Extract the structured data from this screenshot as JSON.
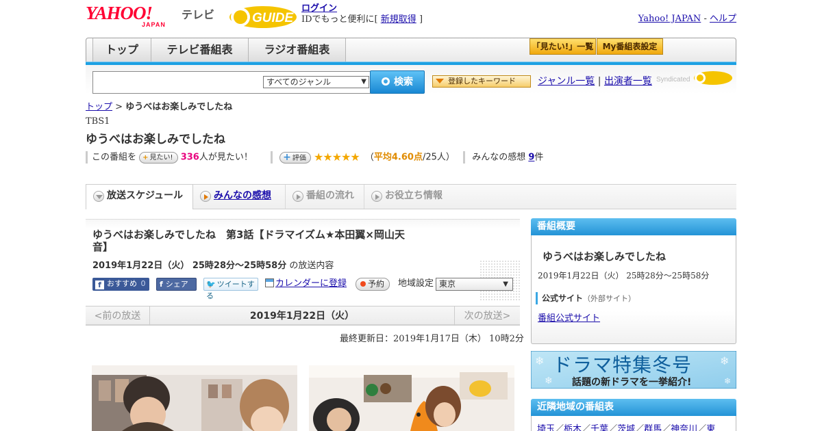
{
  "header": {
    "brand_logo": "YAHOO!",
    "brand_sub": "JAPAN",
    "service_name": "テレビ",
    "gguide_logo": "GUIDE",
    "login_label": "ログイン",
    "login_prefix": "IDでもっと便利に[",
    "signup_label": "新規取得",
    "login_suffix": "]",
    "yahoo_japan_link": "Yahoo! JAPAN",
    "separator": "-",
    "help_link": "ヘルプ"
  },
  "nav": {
    "tabs": [
      "トップ",
      "テレビ番組表",
      "ラジオ番組表"
    ],
    "watchlist_button": "「見たい!」一覧",
    "my_schedule_button": "My番組表設定"
  },
  "search": {
    "genre_selected": "すべてのジャンル",
    "search_button": "検索",
    "keyword_button": "登録したキーワード",
    "genre_list_link": "ジャンル一覧",
    "link_separator": "|",
    "performer_list_link": "出演者一覧",
    "syndicated_label": "Syndicated"
  },
  "breadcrumb": {
    "home": "トップ",
    "separator": ">",
    "current": "ゆうべはお楽しみでしたね"
  },
  "program": {
    "channel": "TBS1",
    "title": "ゆうべはお楽しみでしたね",
    "want_prefix": "この番組を",
    "want_button": "見たい!",
    "want_count": "336",
    "want_suffix": "人が見たい！",
    "rate_button": "評価",
    "stars": "★★★★★",
    "rating_open": "（",
    "rating_avg": "平均4.60点",
    "rating_count": "/25人）",
    "impressions_label": "みんなの感想",
    "impressions_count": "9",
    "impressions_unit": "件"
  },
  "tabs": [
    {
      "label": "放送スケジュール",
      "state": "active"
    },
    {
      "label": "みんなの感想",
      "state": "link"
    },
    {
      "label": "番組の流れ",
      "state": "disabled"
    },
    {
      "label": "お役立ち情報",
      "state": "disabled"
    }
  ],
  "episode": {
    "title": "ゆうべはお楽しみでしたね　第3話【ドラマイズム★本田翼×岡山天音】",
    "airtime": "2019年1月22日（火） 25時28分～25時58分",
    "airtime_suffix": "の放送内容",
    "recommend_button": "おすすめ",
    "recommend_count": "0",
    "share_button": "シェア",
    "tweet_button": "ツイートする",
    "calendar_link": "カレンダーに登録",
    "reserve_button": "予約",
    "region_label": "地域設定",
    "region_selected": "東京"
  },
  "date_nav": {
    "prev": "<前の放送",
    "current": "2019年1月22日（火）",
    "next": "次の放送>"
  },
  "updated": "最終更新日：2019年1月17日（木） 10時2分",
  "sidebar": {
    "overview_heading": "番組概要",
    "overview_title": "ゆうべはお楽しみでしたね",
    "overview_time": "2019年1月22日（火） 25時28分～25時58分",
    "official_label": "公式サイト",
    "official_note": "（外部サイト）",
    "official_link": "番組公式サイト",
    "banner_title": "ドラマ特集冬号",
    "banner_sub": "話題の新ドラマを一挙紹介!",
    "nearby_heading": "近隣地域の番組表",
    "nearby_regions": [
      "埼玉",
      "栃木",
      "千葉",
      "茨城",
      "群馬",
      "神奈川",
      "東"
    ]
  },
  "colors": {
    "yahoo_red": "#ff0033",
    "accent_blue": "#1ea1e3",
    "gguide_yellow": "#f5c400",
    "link": "#1a0dab",
    "highlight_pink": "#e8007e",
    "star": "#f3a700"
  }
}
